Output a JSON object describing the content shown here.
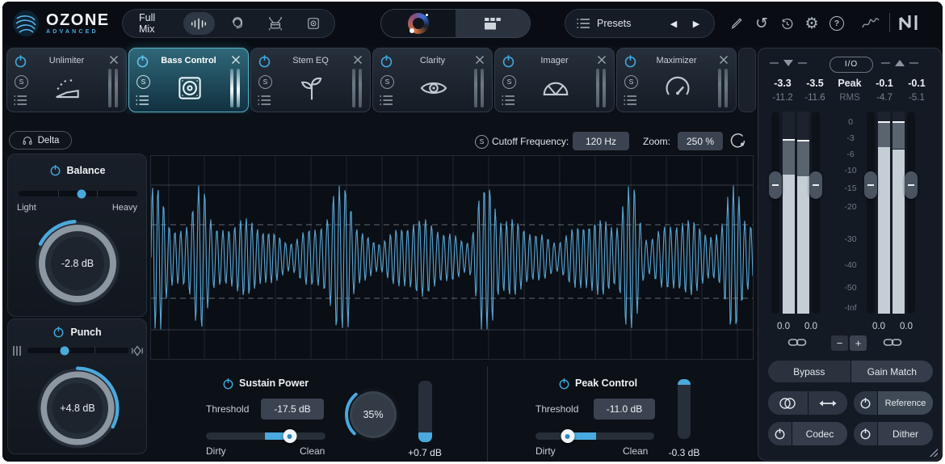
{
  "topbar": {
    "brand": "OZONE",
    "brand_sub": "ADVANCED",
    "mix_mode": "Full Mix",
    "presets": "Presets",
    "prev_icon": "◀",
    "next_icon": "▶",
    "undo_icon": "↺",
    "gear_icon": "⚙",
    "help_icon": "?"
  },
  "solo_badge": "S",
  "modules": [
    {
      "name": "Unlimiter"
    },
    {
      "name": "Bass Control"
    },
    {
      "name": "Stem EQ"
    },
    {
      "name": "Clarity"
    },
    {
      "name": "Imager"
    },
    {
      "name": "Maximizer"
    }
  ],
  "delta": {
    "label": "Delta"
  },
  "balance": {
    "title": "Balance",
    "min_label": "Light",
    "max_label": "Heavy",
    "value": "-2.8 dB",
    "slider_pos": 0.53,
    "arc_start": -152,
    "arc_span": 58
  },
  "punch": {
    "title": "Punch",
    "value": "+4.8 dB",
    "slider_pos": 0.37,
    "arc_start": -90,
    "arc_span": 118
  },
  "wave_header": {
    "cutoff_label": "Cutoff Frequency:",
    "cutoff_value": "120 Hz",
    "zoom_label": "Zoom:",
    "zoom_value": "250 %"
  },
  "sustain": {
    "title": "Sustain Power",
    "threshold_label": "Threshold",
    "threshold_value": "-17.5 dB",
    "min_label": "Dirty",
    "max_label": "Clean",
    "slider_pos": 0.7,
    "fill_from": 0.49,
    "knob_value": "35%",
    "arc_start": 135,
    "arc_span": 95,
    "meter_value": "+0.7 dB",
    "meter_fill": 0.16,
    "meter_side": "bottom"
  },
  "peak": {
    "title": "Peak Control",
    "threshold_label": "Threshold",
    "threshold_value": "-11.0 dB",
    "min_label": "Dirty",
    "max_label": "Clean",
    "slider_pos": 0.27,
    "fill_from": 0.51,
    "meter_value": "-0.3 dB",
    "meter_fill": 0.1,
    "meter_side": "top"
  },
  "io": {
    "label": "I/O",
    "peak_label": "Peak",
    "rms_label": "RMS",
    "input": {
      "peak": [
        "-3.3",
        "-3.5"
      ],
      "rms": [
        "-11.2",
        "-11.6"
      ],
      "gain": [
        "0.0",
        "0.0"
      ],
      "peak_db": [
        -3.3,
        -3.5
      ],
      "rms_db": [
        -11.2,
        -11.6
      ],
      "fader_db": [
        -14,
        -14
      ]
    },
    "output": {
      "peak": [
        "-0.1",
        "-0.1"
      ],
      "rms": [
        "-4.7",
        "-5.1"
      ],
      "gain": [
        "0.0",
        "0.0"
      ],
      "peak_db": [
        -0.1,
        -0.1
      ],
      "rms_db": [
        -4.7,
        -5.1
      ],
      "fader_db": [
        -14,
        -14
      ]
    },
    "scale": [
      "0",
      "-3",
      "-6",
      "-10",
      "-15",
      "-20",
      "-30",
      "-40",
      "-50",
      "-Inf"
    ],
    "minus": "−",
    "plus": "+",
    "buttons": {
      "bypass": "Bypass",
      "gain_match": "Gain Match",
      "reference": "Reference",
      "codec": "Codec",
      "dither": "Dither"
    }
  },
  "colors": {
    "accent_blue": "#4aa9dd",
    "waveform": "#5fb0de",
    "selected_module": "#2f6879"
  },
  "waveform": {
    "bursts": [
      0.005,
      0.082,
      0.318,
      0.556,
      0.797,
      0.968
    ],
    "base_amp": 0.5,
    "period": 7.2,
    "sigma": 11,
    "color": "#5fb0de"
  }
}
